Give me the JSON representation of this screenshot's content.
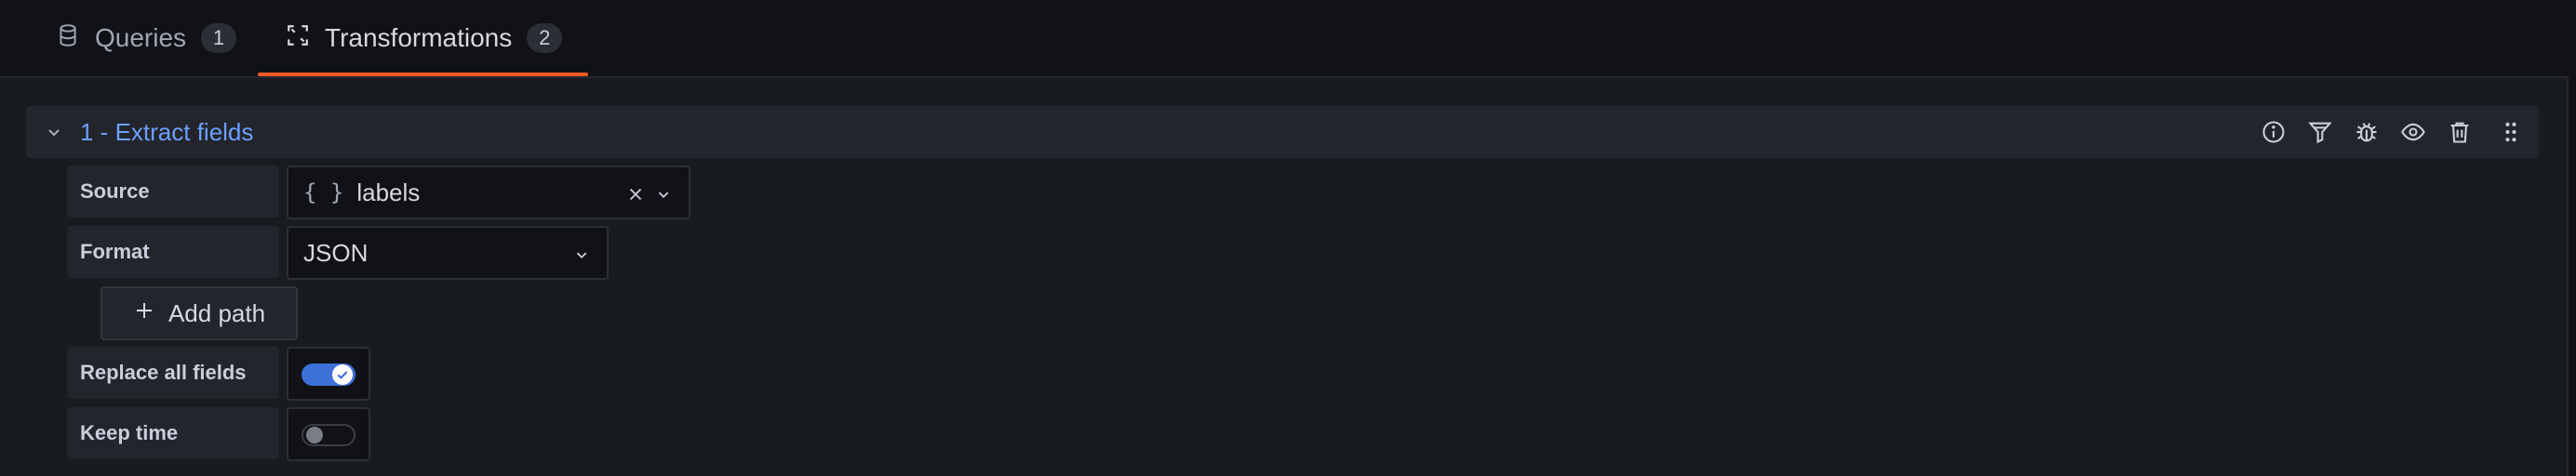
{
  "tabs": [
    {
      "label": "Queries",
      "count": "1",
      "icon": "database-icon",
      "active": false
    },
    {
      "label": "Transformations",
      "count": "2",
      "icon": "transform-icon",
      "active": true
    }
  ],
  "transformation": {
    "title": "1 - Extract fields",
    "actions": [
      "info-icon",
      "filter-icon",
      "debug-icon",
      "eye-icon",
      "trash-icon",
      "drag-handle-icon"
    ],
    "source": {
      "label": "Source",
      "value": "labels",
      "prefix": "{ }"
    },
    "format": {
      "label": "Format",
      "value": "JSON"
    },
    "add_path_label": "Add path",
    "replace_all_fields": {
      "label": "Replace all fields",
      "enabled": true
    },
    "keep_time": {
      "label": "Keep time",
      "enabled": false
    }
  },
  "colors": {
    "accent_tab": "#f05a28",
    "title_blue": "#6e9fff",
    "switch_on": "#3d71d9",
    "background": "#111217",
    "panel": "#181b1f"
  }
}
